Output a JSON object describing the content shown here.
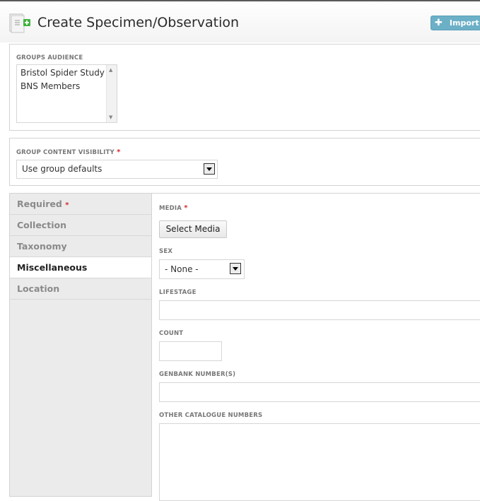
{
  "header": {
    "title": "Create Specimen/Observation",
    "import_label": "Import in",
    "import_icon": "plus-icon",
    "page_icon": "document-add-icon"
  },
  "groups_audience": {
    "label": "GROUPS AUDIENCE",
    "options": [
      "Bristol Spider Study",
      "BNS Members"
    ]
  },
  "group_visibility": {
    "label": "GROUP CONTENT VISIBILITY",
    "required_mark": "*",
    "selected": "Use group defaults"
  },
  "tabs": [
    {
      "label": "Required",
      "required_mark": "*",
      "active": false
    },
    {
      "label": "Collection",
      "active": false
    },
    {
      "label": "Taxonomy",
      "active": false
    },
    {
      "label": "Miscellaneous",
      "active": true
    },
    {
      "label": "Location",
      "active": false
    }
  ],
  "fields": {
    "media": {
      "label": "MEDIA",
      "required_mark": "*",
      "button": "Select Media"
    },
    "sex": {
      "label": "SEX",
      "selected": "- None -"
    },
    "lifestage": {
      "label": "LIFESTAGE",
      "value": ""
    },
    "count": {
      "label": "COUNT",
      "value": ""
    },
    "genbank": {
      "label": "GENBANK NUMBER(S)",
      "value": ""
    },
    "other_catalogue": {
      "label": "OTHER CATALOGUE NUMBERS",
      "value": ""
    }
  },
  "colors": {
    "import_button": "#6cb0c7",
    "required": "#d8262b",
    "tab_background": "#ebebeb"
  }
}
